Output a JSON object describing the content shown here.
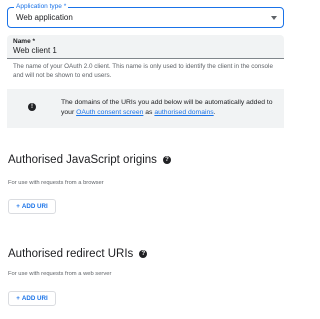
{
  "app_type": {
    "label": "Application type *",
    "value": "Web application"
  },
  "name_field": {
    "label": "Name *",
    "value": "Web client 1",
    "help_text": "The name of your OAuth 2.0 client. This name is only used to identify the client in the console and will not be shown to end users."
  },
  "info_banner": {
    "text_before": "The domains of the URIs you add below will be automatically added to your ",
    "link1": "OAuth consent screen",
    "text_middle": " as ",
    "link2": "authorised domains",
    "text_after": "."
  },
  "js_origins": {
    "title": "Authorised JavaScript origins",
    "subtitle": "For use with requests from a browser",
    "button": "ADD URI"
  },
  "redirect_uris": {
    "title": "Authorised redirect URIs",
    "subtitle": "For use with requests from a web server",
    "button": "ADD URI"
  },
  "icons": {
    "dropdown": "chevron-down-icon",
    "info": "info-icon",
    "help": "help-icon",
    "add": "plus-icon"
  },
  "colors": {
    "accent": "#1a73e8",
    "banner_bg": "#f1f3f4",
    "text_primary": "#202124",
    "text_secondary": "#5f6368"
  }
}
